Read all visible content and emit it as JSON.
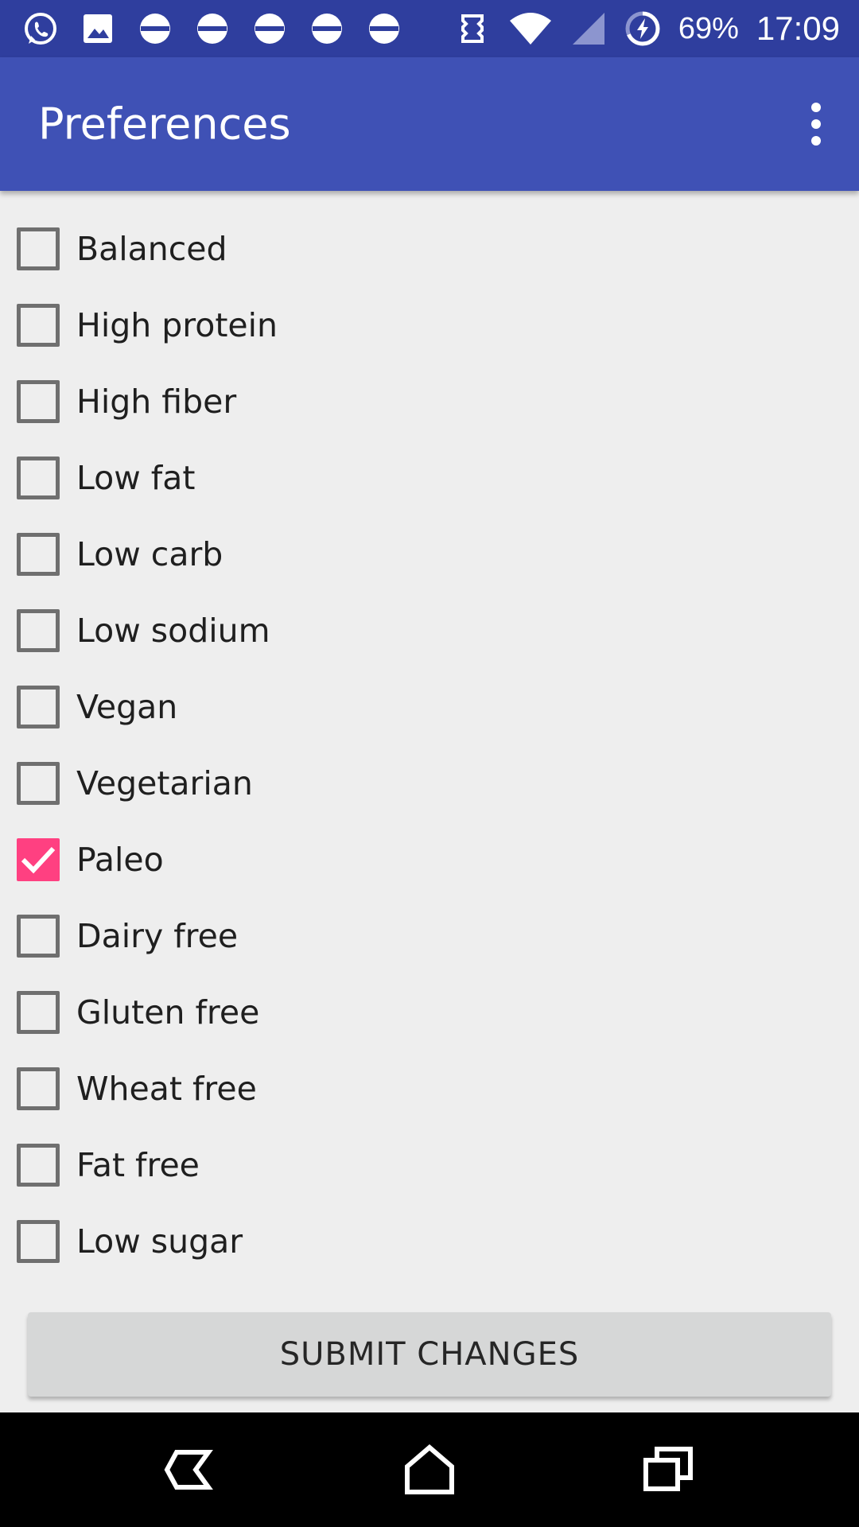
{
  "status_bar": {
    "notification_icons": [
      "whatsapp-icon",
      "image-icon",
      "notification-dot-icon",
      "notification-dot-icon",
      "notification-dot-icon",
      "notification-dot-icon",
      "notification-dot-icon"
    ],
    "system_icons": [
      "vibrate-icon",
      "wifi-icon",
      "signal-icon",
      "battery-charging-icon"
    ],
    "battery": "69%",
    "time": "17:09"
  },
  "app_bar": {
    "title": "Preferences",
    "overflow_icon": "more-vert-icon"
  },
  "preferences": [
    {
      "label": "Balanced",
      "checked": false
    },
    {
      "label": "High protein",
      "checked": false
    },
    {
      "label": "High fiber",
      "checked": false
    },
    {
      "label": "Low fat",
      "checked": false
    },
    {
      "label": "Low carb",
      "checked": false
    },
    {
      "label": "Low sodium",
      "checked": false
    },
    {
      "label": "Vegan",
      "checked": false
    },
    {
      "label": "Vegetarian",
      "checked": false
    },
    {
      "label": "Paleo",
      "checked": true
    },
    {
      "label": "Dairy free",
      "checked": false
    },
    {
      "label": "Gluten free",
      "checked": false
    },
    {
      "label": "Wheat free",
      "checked": false
    },
    {
      "label": "Fat free",
      "checked": false
    },
    {
      "label": "Low sugar",
      "checked": false
    }
  ],
  "submit_button": {
    "label": "SUBMIT CHANGES"
  },
  "nav_bar": {
    "back_icon": "back-icon",
    "home_icon": "home-icon",
    "recents_icon": "recents-icon"
  },
  "colors": {
    "status_bar": "#2f3e9e",
    "app_bar": "#3f51b5",
    "accent": "#ff4081",
    "background": "#eeeeee"
  }
}
